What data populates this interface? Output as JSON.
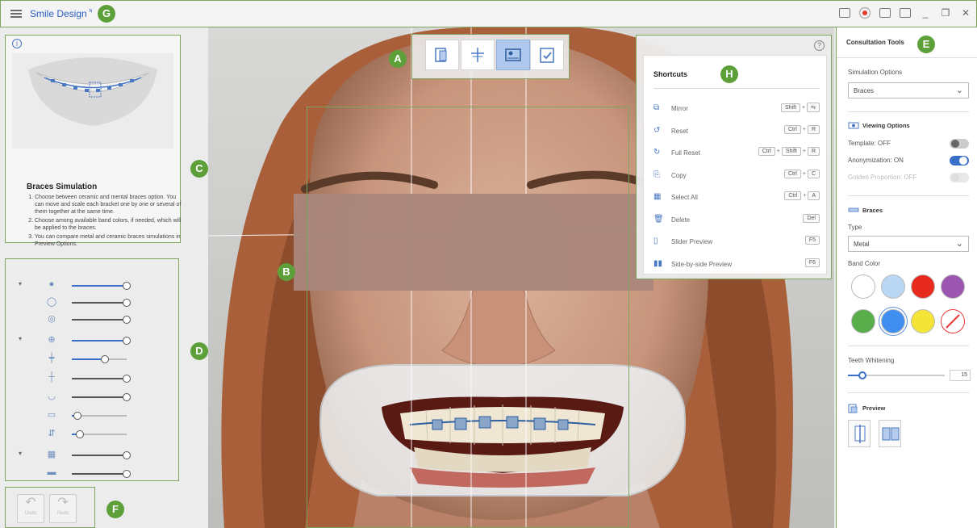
{
  "app": {
    "title": "Smile Design",
    "title_mark": "ᴺ"
  },
  "badges": {
    "A": "A",
    "B": "B",
    "C": "C",
    "D": "D",
    "E": "E",
    "F": "F",
    "G": "G",
    "H": "H"
  },
  "guide": {
    "title": "Braces Simulation",
    "steps": [
      "Choose between ceramic and mental braces option. You can move and scale each bracket one by one or several of them together at the same time.",
      "Choose among available band colors, if needed, which will be applied to the braces.",
      "You can compare metal and ceramic braces simulations in Preview Options."
    ]
  },
  "sliders": [
    {
      "level": 1.0
    },
    {
      "level": 1.0
    },
    {
      "level": 1.0
    },
    {
      "level": 1.0
    },
    {
      "level": 0.6
    },
    {
      "level": 1.0
    },
    {
      "level": 1.0
    },
    {
      "level": 0.1
    },
    {
      "level": 0.15
    },
    {
      "level": 1.0
    },
    {
      "level": 1.0
    }
  ],
  "undo": {
    "undo_label": "Undo",
    "redo_label": "Redo"
  },
  "shortcuts": {
    "title": "Shortcuts",
    "items": [
      {
        "label": "Mirror",
        "keys": [
          "Shift",
          "+",
          "⇆"
        ]
      },
      {
        "label": "Reset",
        "keys": [
          "Ctrl",
          "+",
          "R"
        ]
      },
      {
        "label": "Full Reset",
        "keys": [
          "Ctrl",
          "+",
          "Shift",
          "+",
          "R"
        ]
      },
      {
        "label": "Copy",
        "keys": [
          "Ctrl",
          "+",
          "C"
        ]
      },
      {
        "label": "Select All",
        "keys": [
          "Ctrl",
          "+",
          "A"
        ]
      },
      {
        "label": "Delete",
        "keys": [
          "Del"
        ]
      },
      {
        "label": "Slider Preview",
        "keys": [
          "F5"
        ]
      },
      {
        "label": "Side-by-side Preview",
        "keys": [
          "F6"
        ]
      }
    ]
  },
  "consultation": {
    "title": "Consultation Tools",
    "simulation_label": "Simulation Options",
    "simulation_value": "Braces",
    "viewing_title": "Viewing Options",
    "template_label": "Template: OFF",
    "template_on": false,
    "anonym_label": "Anonymization: ON",
    "anonym_on": true,
    "golden_label": "Golden Proportion: OFF",
    "golden_on": false,
    "braces_title": "Braces",
    "type_label": "Type",
    "type_value": "Metal",
    "band_label": "Band Color",
    "colors": [
      "#ffffff",
      "#b9d6f2",
      "#e8291d",
      "#9c55b0",
      "#5aad4b",
      "#3f8ef0",
      "#f4e437",
      "none"
    ],
    "selected_color": 5,
    "whitening_label": "Teeth Whitening",
    "whitening_value": "15",
    "whitening_level": 0.15,
    "preview_title": "Preview"
  }
}
